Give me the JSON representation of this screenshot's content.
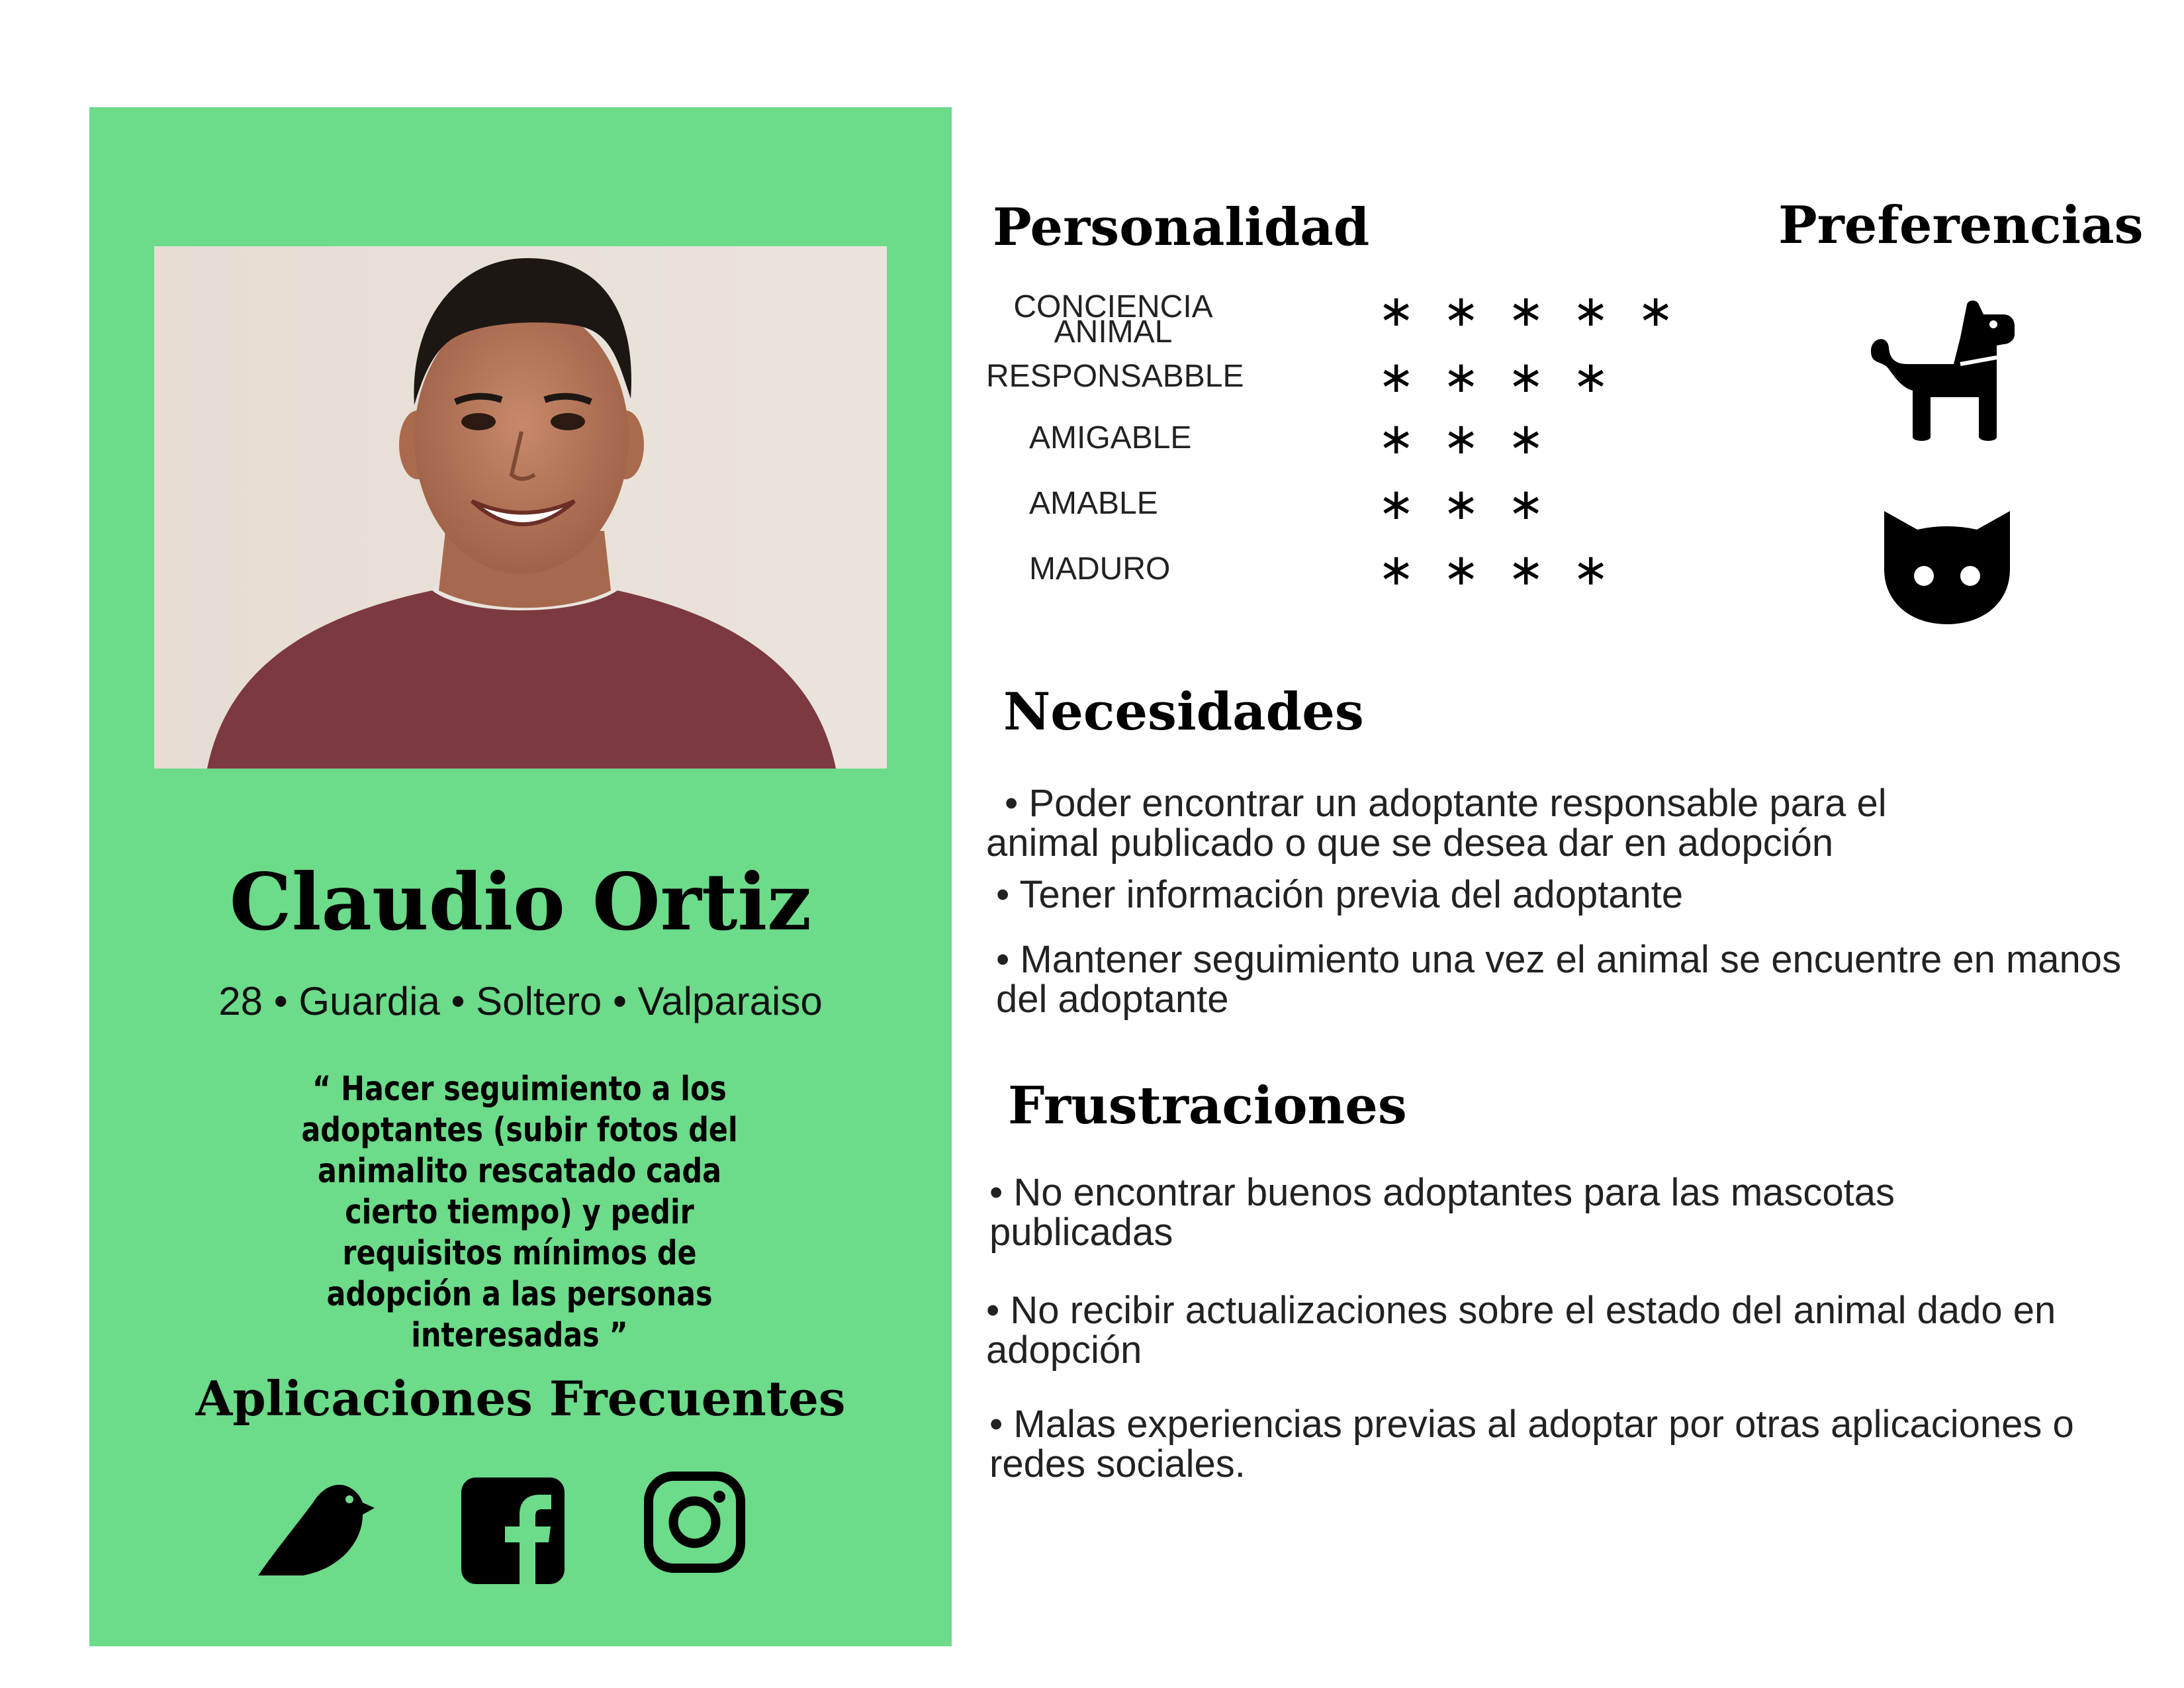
{
  "persona": {
    "name": "Claudio Ortiz",
    "meta": "28 • Guardia • Soltero • Valparaiso",
    "quote": "“ Hacer seguimiento a los adoptantes (subir fotos del animalito rescatado cada cierto tiempo) y pedir requisitos mínimos de adopción a las personas interesadas ”"
  },
  "apps": {
    "title": "Aplicaciones Frecuentes",
    "icons": [
      "twitter-bird-icon",
      "facebook-icon",
      "instagram-icon"
    ]
  },
  "personality": {
    "title": "Personalidad",
    "traits": [
      {
        "label": "CONCIENCIA ANIMAL",
        "rating": 5
      },
      {
        "label": "RESPONSABBLE",
        "rating": 4
      },
      {
        "label": "AMIGABLE",
        "rating": 3
      },
      {
        "label": "AMABLE",
        "rating": 3
      },
      {
        "label": "MADURO",
        "rating": 4
      }
    ],
    "star_glyph": "∗"
  },
  "preferences": {
    "title": "Preferencias",
    "icons": [
      "dog-icon",
      "cat-icon"
    ]
  },
  "needs": {
    "title": "Necesidades",
    "items": [
      "• Poder encontrar un adoptante responsable para el animal publicado o que se desea dar en adopción",
      "• Tener información previa del adoptante",
      "• Mantener seguimiento una vez el animal se encuentre en manos del adoptante"
    ]
  },
  "frustrations": {
    "title": "Frustraciones",
    "items": [
      "• No encontrar buenos adoptantes para las mascotas publicadas",
      "• No recibir actualizaciones sobre el estado del animal dado en adopción",
      "• Malas experiencias previas al adoptar por otras aplicaciones o redes sociales."
    ]
  },
  "colors": {
    "card": "#6cdb8a",
    "text": "#000000"
  }
}
